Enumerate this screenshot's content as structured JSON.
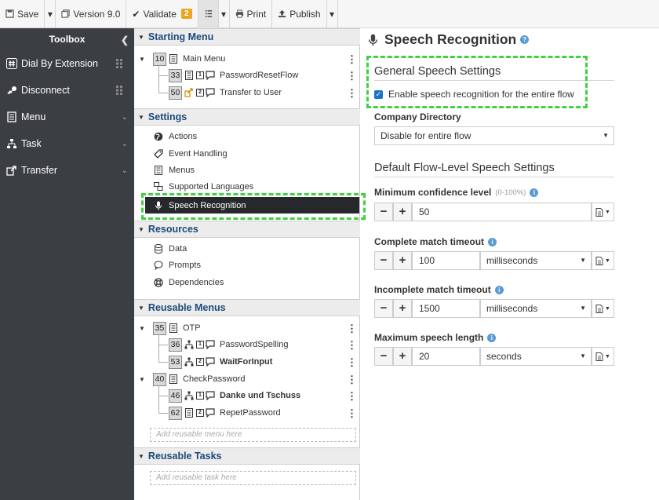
{
  "toolbar": {
    "save": "Save",
    "version": "Version 9.0",
    "validate": "Validate",
    "validate_count": "2",
    "print": "Print",
    "publish": "Publish"
  },
  "sidebar": {
    "title": "Toolbox",
    "items": [
      {
        "label": "Dial By Extension",
        "icon": "hash-icon"
      },
      {
        "label": "Disconnect",
        "icon": "disconnect-icon"
      },
      {
        "label": "Menu",
        "icon": "menu-icon"
      },
      {
        "label": "Task",
        "icon": "task-icon"
      },
      {
        "label": "Transfer",
        "icon": "transfer-icon"
      }
    ]
  },
  "tree": {
    "starting_menu": {
      "title": "Starting Menu",
      "main": {
        "num": "10",
        "label": "Main Menu"
      },
      "children": [
        {
          "num": "33",
          "key": "1",
          "label": "PasswordResetFlow"
        },
        {
          "num": "50",
          "key": "2",
          "label": "Transfer to User"
        }
      ]
    },
    "settings": {
      "title": "Settings",
      "items": [
        "Actions",
        "Event Handling",
        "Menus",
        "Supported Languages",
        "Speech Recognition"
      ]
    },
    "resources": {
      "title": "Resources",
      "items": [
        "Data",
        "Prompts",
        "Dependencies"
      ]
    },
    "reusable_menus": {
      "title": "Reusable Menus",
      "otp": {
        "num": "35",
        "label": "OTP"
      },
      "otp_children": [
        {
          "num": "36",
          "key": "1",
          "label": "PasswordSpelling"
        },
        {
          "num": "53",
          "key": "2",
          "label": "WaitForInput"
        }
      ],
      "check": {
        "num": "40",
        "label": "CheckPassword"
      },
      "check_children": [
        {
          "num": "46",
          "key": "1",
          "label": "Danke und Tschuss"
        },
        {
          "num": "62",
          "key": "2",
          "label": "RepetPassword"
        }
      ],
      "add_placeholder": "Add reusable menu here"
    },
    "reusable_tasks": {
      "title": "Reusable Tasks",
      "add_placeholder": "Add reusable task here"
    }
  },
  "main": {
    "title": "Speech Recognition",
    "general_title": "General Speech Settings",
    "enable_label": "Enable speech recognition for the entire flow",
    "enable_checked": true,
    "company_dir_label": "Company Directory",
    "company_dir_value": "Disable for entire flow",
    "default_title": "Default Flow-Level Speech Settings",
    "min_conf_label": "Minimum confidence level",
    "min_conf_range": "(0-100%)",
    "min_conf_value": "50",
    "complete_label": "Complete match timeout",
    "complete_value": "100",
    "complete_unit": "milliseconds",
    "incomplete_label": "Incomplete match timeout",
    "incomplete_value": "1500",
    "incomplete_unit": "milliseconds",
    "maxlen_label": "Maximum speech length",
    "maxlen_value": "20",
    "maxlen_unit": "seconds"
  }
}
